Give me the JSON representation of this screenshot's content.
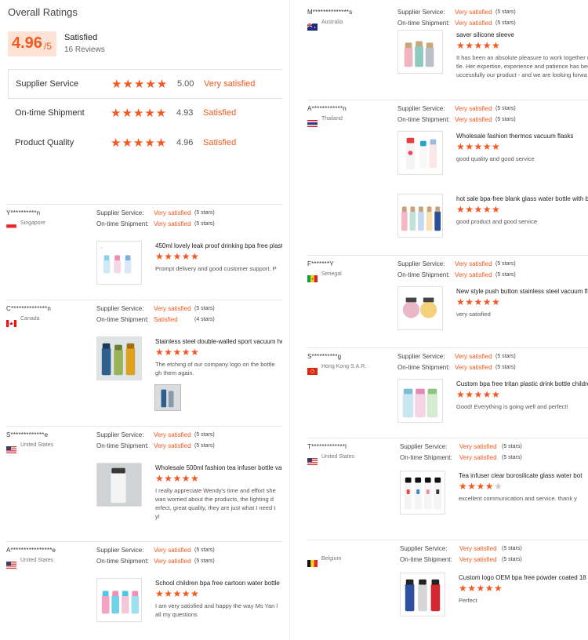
{
  "summary": {
    "title": "Overall Ratings",
    "score": "4.96",
    "score_denominator": "/5",
    "label": "Satisfied",
    "reviews_count": "16 Reviews",
    "criteria": [
      {
        "name": "Supplier Service",
        "stars": 5,
        "score": "5.00",
        "label": "Very satisfied"
      },
      {
        "name": "On-time Shipment",
        "stars": 5,
        "score": "4.93",
        "label": "Satisfied"
      },
      {
        "name": "Product Quality",
        "stars": 5,
        "score": "4.96",
        "label": "Satisfied"
      }
    ]
  },
  "labels": {
    "supplier_service": "Supplier Service:",
    "on_time_shipment": "On-time Shipment:"
  },
  "reviews_left": [
    {
      "buyer": "Y**********n",
      "country": "Singapore",
      "flag": "sg",
      "service": "Very satisfied",
      "service_stars": "(5 stars)",
      "shipment": "Very satisfied",
      "shipment_stars": "(5 stars)",
      "products": [
        {
          "title": "450ml lovely leak proof drinking bpa free plast",
          "stars": 5,
          "text": [
            "Prompt delivery and good customer support. P"
          ],
          "image": "kids-bottles"
        }
      ]
    },
    {
      "buyer": "C**************n",
      "country": "Canada",
      "flag": "ca",
      "service": "Very satisfied",
      "service_stars": "(5 stars)",
      "shipment": "Satisfied",
      "shipment_stars": "(4 stars)",
      "products": [
        {
          "title": "Stainless steel double-walled sport vacuum he",
          "stars": 5,
          "text": [
            "The etching of our company logo on the bottle",
            "gh them again."
          ],
          "image": "sport-bottles"
        }
      ]
    },
    {
      "buyer": "S*************e",
      "country": "United States",
      "flag": "us",
      "service": "Very satisfied",
      "service_stars": "(5 stars)",
      "shipment": "Very satisfied",
      "shipment_stars": "(5 stars)",
      "products": [
        {
          "title": "Wholesale 500ml fashion tea infuser bottle va",
          "stars": 5,
          "text": [
            "I really appreciate Wendy's time and effort she",
            "was worried about the products, the lighting d",
            "erfect, great quality, they are just what I need t",
            "y!"
          ],
          "image": "tea-infuser"
        }
      ]
    },
    {
      "buyer": "A****************e",
      "country": "United States",
      "flag": "us",
      "service": "Very satisfied",
      "service_stars": "(5 stars)",
      "shipment": "Very satisfied",
      "shipment_stars": "(5 stars)",
      "products": [
        {
          "title": "School children bpa free cartoon water bottle",
          "stars": 5,
          "text": [
            "I am very satisfied and happy the way Ms Yan l",
            "all my questions"
          ],
          "image": "cartoon-bottles"
        }
      ]
    }
  ],
  "reviews_right": [
    {
      "buyer": "M**************s",
      "country": "Australia",
      "flag": "au",
      "service": "Very satisfied",
      "service_stars": "(5 stars)",
      "shipment": "Very satisfied",
      "shipment_stars": "(5 stars)",
      "products": [
        {
          "title": "saver silicone sleeve",
          "stars": 5,
          "text": [
            "It has been an absolute pleasure to work together w",
            "tle. Her expertise, experience and patience has bee",
            "uccessfully our product - and we are looking forwa"
          ],
          "image": "glass-sleeve"
        }
      ]
    },
    {
      "buyer": "A************n",
      "country": "Thailand",
      "flag": "th",
      "service": "Very satisfied",
      "service_stars": "(5 stars)",
      "shipment": "Very satisfied",
      "shipment_stars": "(5 stars)",
      "products": [
        {
          "title": "Wholesale fashion thermos vacuum flasks",
          "stars": 5,
          "text": [
            "good quality and good service"
          ],
          "image": "thermos"
        },
        {
          "title": "hot sale bpa-free blank glass water bottle with bar",
          "stars": 5,
          "text": [
            "good product and good service"
          ],
          "image": "glass-bottles"
        }
      ]
    },
    {
      "buyer": "F*******Y",
      "country": "Senegal",
      "flag": "sn",
      "service": "Very satisfied",
      "service_stars": "(5 stars)",
      "shipment": "Very satisfied",
      "shipment_stars": "(5 stars)",
      "products": [
        {
          "title": "New style push button stainless steel vacuum flas",
          "stars": 5,
          "text": [
            "very satisfied"
          ],
          "image": "push-flask"
        }
      ]
    },
    {
      "buyer": "S**********g",
      "country": "Hong Kong S.A.R.",
      "flag": "hk",
      "service": "Very satisfied",
      "service_stars": "(5 stars)",
      "shipment": "Very satisfied",
      "shipment_stars": "(5 stars)",
      "products": [
        {
          "title": "Custom bpa free tritan plastic drink bottle children",
          "stars": 5,
          "text": [
            "Good! Everything is going well and perfect!"
          ],
          "image": "tritan-bottles"
        }
      ]
    },
    {
      "buyer": "T*************l",
      "country": "United States",
      "flag": "us",
      "service": "Very satisfied",
      "service_stars": "(5 stars)",
      "shipment": "Very satisfied",
      "shipment_stars": "(5 stars)",
      "products": [
        {
          "title": "Tea infuser clear borosilicate glass water bot",
          "stars": 4,
          "text": [
            "excellent communication and service. thank y"
          ],
          "image": "infuser-bottles"
        }
      ]
    },
    {
      "buyer": "",
      "country": "Belgium",
      "flag": "be",
      "service": "Very satisfied",
      "service_stars": "(5 stars)",
      "shipment": "Very satisfied",
      "shipment_stars": "(5 stars)",
      "products": [
        {
          "title": "Custom logo OEM bpa free powder coated 18",
          "stars": 5,
          "text": [
            "Perfect"
          ],
          "image": "powder-bottles"
        }
      ]
    }
  ],
  "colors": {
    "accent": "#f2581f",
    "score_bg": "#fde3d6",
    "divider": "#e6e6e6"
  }
}
